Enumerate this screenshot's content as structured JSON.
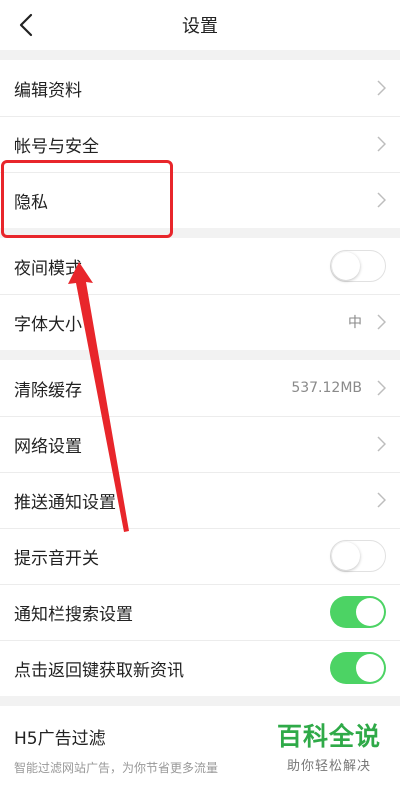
{
  "header": {
    "title": "设置"
  },
  "group1": [
    {
      "label": "编辑资料"
    },
    {
      "label": "帐号与安全"
    },
    {
      "label": "隐私"
    }
  ],
  "group2": {
    "night_mode": {
      "label": "夜间模式",
      "on": false
    },
    "font_size": {
      "label": "字体大小",
      "value": "中"
    }
  },
  "group3": {
    "clear_cache": {
      "label": "清除缓存",
      "value": "537.12MB"
    },
    "network": {
      "label": "网络设置"
    },
    "push": {
      "label": "推送通知设置"
    },
    "sound": {
      "label": "提示音开关",
      "on": false
    },
    "notif_search": {
      "label": "通知栏搜索设置",
      "on": true
    },
    "back_refresh": {
      "label": "点击返回键获取新资讯",
      "on": true
    }
  },
  "ad_filter": {
    "title": "H5广告过滤",
    "subtitle": "智能过滤网站广告，为你节省更多流量"
  },
  "watermark": {
    "big": "百科全说",
    "small": "助你轻松解决"
  },
  "colors": {
    "toggle_on": "#4cd364",
    "annotation_red": "#e8262b",
    "watermark_green": "#2faa48"
  }
}
